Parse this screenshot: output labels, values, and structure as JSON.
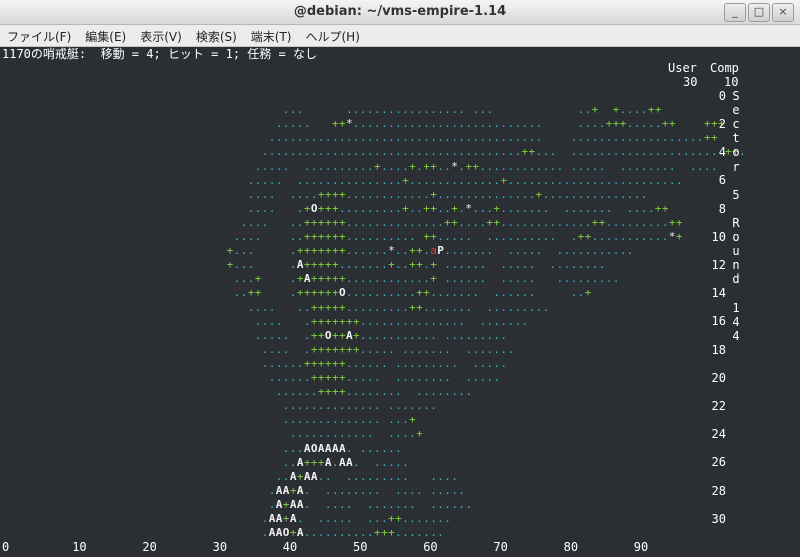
{
  "window": {
    "title": "@debian: ~/vms-empire-1.14",
    "minimize": "_",
    "maximize": "□",
    "close": "×"
  },
  "menu": [
    "ファイル(F)",
    "編集(E)",
    "表示(V)",
    "検索(S)",
    "端末(T)",
    "ヘルプ(H)"
  ],
  "status_line": "1170の哨戒艇:  移動 = 4; ヒット = 1; 任務 = なし",
  "score": {
    "user_label": "User",
    "comp_label": "Comp",
    "user_value": "30",
    "comp_value": "10",
    "row0": "0",
    "sector_word": [
      "S",
      "e",
      "c",
      "t",
      "o",
      "r"
    ],
    "sector_value": "5",
    "round_word": [
      "R",
      "o",
      "u",
      "n",
      "d"
    ],
    "round_value": [
      "1",
      "4",
      "4"
    ]
  },
  "row_labels": [
    "0",
    "2",
    "4",
    "6",
    "8",
    "10",
    "12",
    "14",
    "16",
    "18",
    "20",
    "22",
    "24",
    "26",
    "28",
    "30"
  ],
  "col_labels": [
    "0",
    "10",
    "20",
    "30",
    "40",
    "50",
    "60",
    "70",
    "80",
    "90"
  ],
  "colors": {
    "sea": "#3fb6c7",
    "land": "#7fd13c",
    "enemy": "#e23b3b",
    "unit": "#f2f2f2",
    "background": "#2b2f33"
  },
  "map_rows": [
    "",
    "                                        ...      ................. ...            ..+  +....++",
    "                                       .....   ++*...........................     ....+++.....++    +++",
    "                                      .......................................    ...................++",
    "                                     .....................................++...  ......................++.",
    "                                    .....  ..........+....+.++..*.++............ .....  ........  ....",
    "                                   .....  ...............+.............+.........................",
    "                                   ....  ....++++............+..............+...............",
    "                                   ....   .+O+++.........+..++..+.*...+.......  .......  ....++",
    "                                  ....   ..++++++..............++....++.............++.........++",
    "                                 ....    ..++++++.......... ++.....  ..........  .++...........*+",
    "                                +...     .+++++++......*..++.aP.......  .....  ...........",
    "                                +...     .A+++++.......+..++.+ ......  .....  ........",
    "                                 ...+    .+A+++++............+ ......  .....   .........",
    "                                 ..++    .++++++O..........++.......  ......     ..+",
    "                                   ....   ..+++++.........++.......  .........",
    "                                    ....   .+++++++...............  .......",
    "                                    .....  .++O++A+........... .........",
    "                                     ....  .+++++++..... .......  .......",
    "                                     ......++++++...... .........  .....",
    "                                      ......+++++.....  ........  .....",
    "                                       ......++++........  ........",
    "                                        .............. .......",
    "                                        .............. ...+",
    "                                         ............  ....+",
    "                                        ...AOAAAA. ......",
    "                                        ..A+++A.AA.  .....",
    "                                       ..A+AA..  .........   ....",
    "                                      .AA+A.  ........  .... .....",
    "                                      .A+AA.  ....  .......  ......",
    "                                     .AA+A.  .....  ...++.......",
    "                                     .AAO+A..........+++......."
  ]
}
